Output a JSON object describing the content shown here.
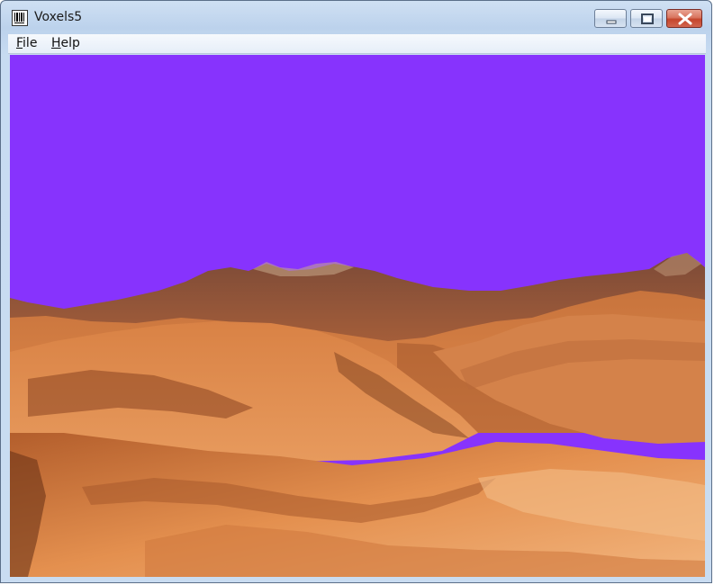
{
  "window": {
    "title": "Voxels5",
    "icon": "app-barcode-icon",
    "controls": [
      "minimize-icon",
      "maximize-icon",
      "close-icon"
    ]
  },
  "menu": {
    "items": [
      {
        "label_accel": "F",
        "label_rest": "ile"
      },
      {
        "label_accel": "H",
        "label_rest": "elp"
      }
    ]
  },
  "scene": {
    "sky_color": "#8733fd",
    "terrain_colors": [
      "#e6955a",
      "#c86f3a",
      "#a9572c",
      "#f0b27a"
    ]
  }
}
